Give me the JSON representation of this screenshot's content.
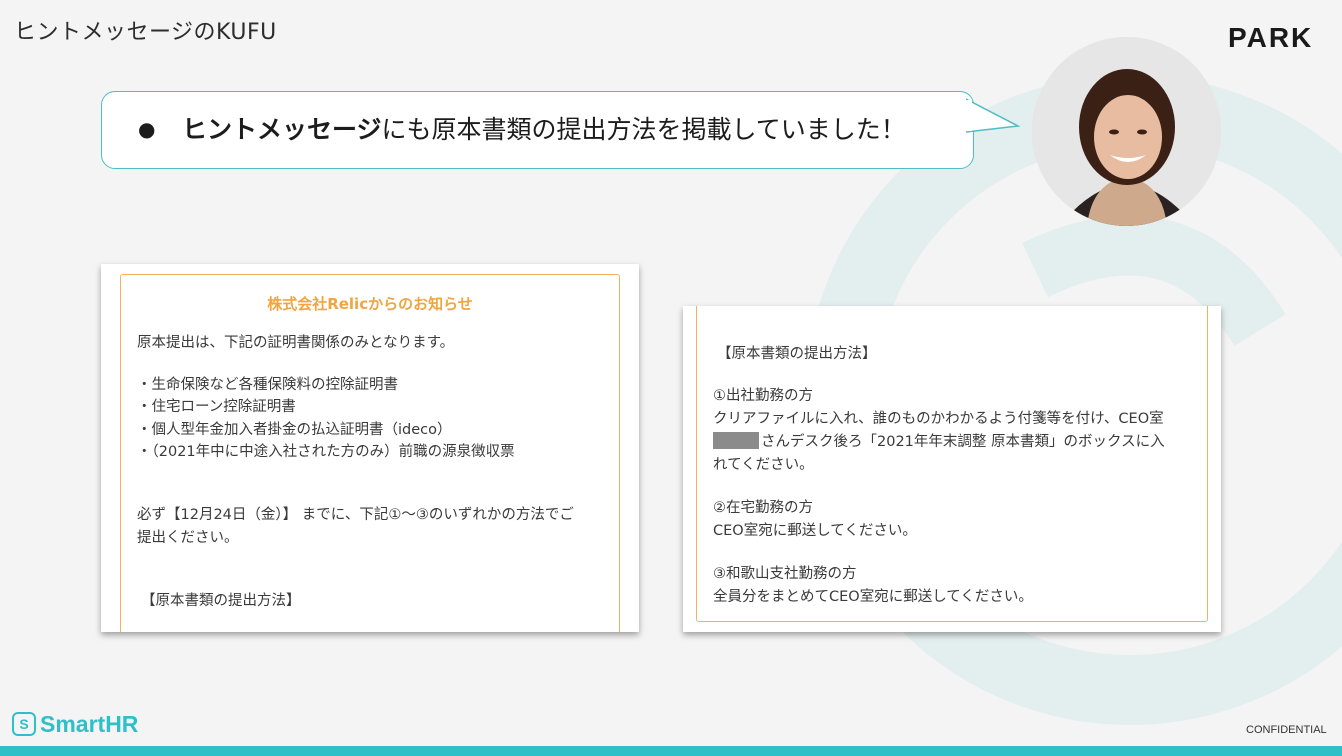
{
  "slide": {
    "title": "ヒントメッセージのKUFU",
    "logo_text": "PARK",
    "confidential": "CONFIDENTIAL"
  },
  "speech": {
    "bullet": "●",
    "bold_text": "ヒントメッセージ",
    "rest_text": "にも原本書類の提出方法を掲載していました！"
  },
  "avatar": {
    "icon": "person-photo"
  },
  "left_card": {
    "header": "株式会社Relicからのお知らせ",
    "lines": [
      "原本提出は、下記の証明書関係のみとなります。",
      "・生命保険など各種保険料の控除証明書",
      "・住宅ローン控除証明書",
      "・個人型年金加入者掛金の払込証明書（ideco）",
      "・（2021年中に中途入社された方のみ）前職の源泉徴収票",
      "必ず【12月24日（金）】 までに、下記①〜③のいずれかの方法でご",
      "提出ください。",
      "【原本書類の提出方法】"
    ]
  },
  "right_card": {
    "lines": [
      "【原本書類の提出方法】",
      "①出社勤務の方",
      "クリアファイルに入れ、誰のものかわかるよう付箋等を付け、CEO室",
      "さんデスク後ろ「2021年年末調整 原本書類」のボックスに入",
      "れてください。",
      "②在宅勤務の方",
      "CEO室宛に郵送してください。",
      "③和歌山支社勤務の方",
      "全員分をまとめてCEO室宛に郵送してください。"
    ]
  },
  "brand": {
    "mark": "S",
    "name": "SmartHR"
  },
  "colors": {
    "accent": "#2ec0c8",
    "notice_orange": "#f0a540",
    "bubble_border": "#4fbdc4"
  }
}
